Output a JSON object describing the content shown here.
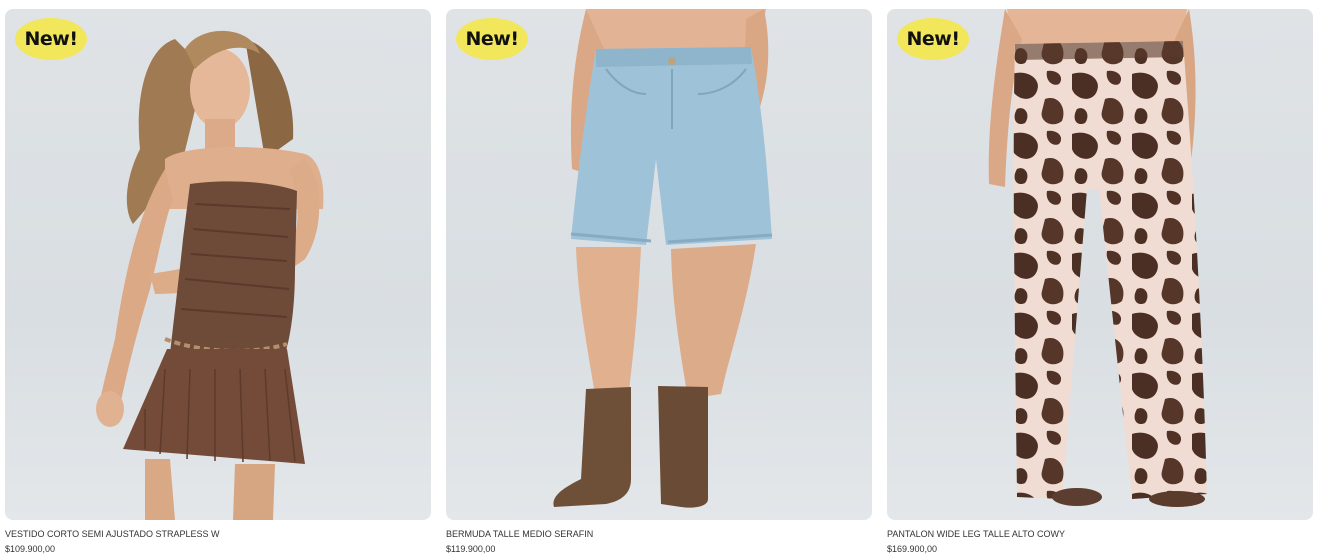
{
  "theme": {
    "badge_color": "#f2e65a"
  },
  "products": [
    {
      "badge": "New!",
      "image_alt": "model wearing brown strapless dress",
      "name": "VESTIDO CORTO SEMI AJUSTADO STRAPLESS W",
      "price": "$109.900,00"
    },
    {
      "badge": "New!",
      "image_alt": "model wearing light denim bermuda shorts and brown boots",
      "name": "BERMUDA TALLE MEDIO SERAFIN",
      "price": "$119.900,00"
    },
    {
      "badge": "New!",
      "image_alt": "model wearing cow print wide leg pants",
      "name": "PANTALON WIDE LEG TALLE ALTO COWY",
      "price": "$169.900,00"
    }
  ]
}
